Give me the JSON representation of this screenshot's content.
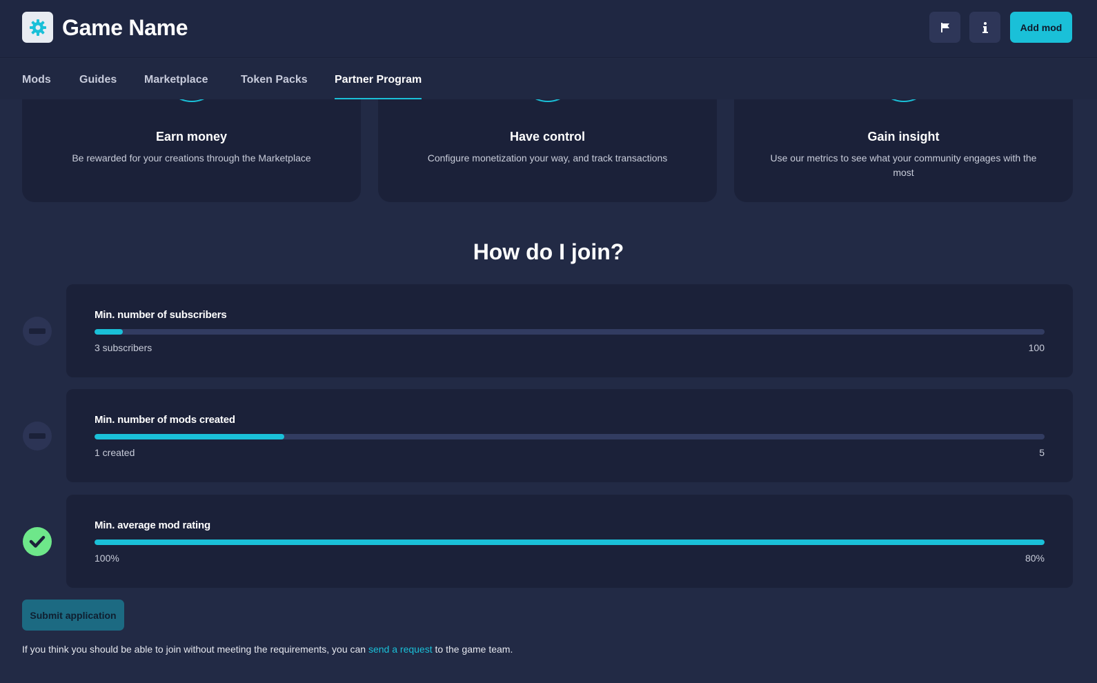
{
  "header": {
    "game_title": "Game Name",
    "add_mod_label": "Add mod",
    "logo_icon": "gear-icon",
    "flag_icon": "flag-icon",
    "info_icon": "info-icon"
  },
  "tabs": [
    {
      "label": "Mods",
      "active": false
    },
    {
      "label": "Guides",
      "active": false
    },
    {
      "label": "Marketplace",
      "active": false
    },
    {
      "label": "Token Packs",
      "active": false
    },
    {
      "label": "Partner Program",
      "active": true
    }
  ],
  "features": [
    {
      "title": "Earn money",
      "description": "Be rewarded for your creations through the Marketplace"
    },
    {
      "title": "Have control",
      "description": "Configure monetization your way, and track transactions"
    },
    {
      "title": "Gain insight",
      "description": "Use our metrics to see what your community engages with the most"
    }
  ],
  "join": {
    "heading": "How do I join?",
    "requirements": [
      {
        "title": "Min. number of subscribers",
        "current_label": "3 subscribers",
        "target_label": "100",
        "progress": 0.03,
        "met": false
      },
      {
        "title": "Min. number of mods created",
        "current_label": "1 created",
        "target_label": "5",
        "progress": 0.2,
        "met": false
      },
      {
        "title": "Min. average mod rating",
        "current_label": "100%",
        "target_label": "80%",
        "progress": 1.0,
        "met": true
      }
    ],
    "submit_label": "Submit application",
    "footnote_before": "If you think you should be able to join without meeting the requirements, you can ",
    "footnote_link": "send a request",
    "footnote_after": " to the game team."
  },
  "colors": {
    "accent": "#1ac0d8",
    "background": "#222a45",
    "card": "#1b2139",
    "success": "#6ee78a"
  }
}
